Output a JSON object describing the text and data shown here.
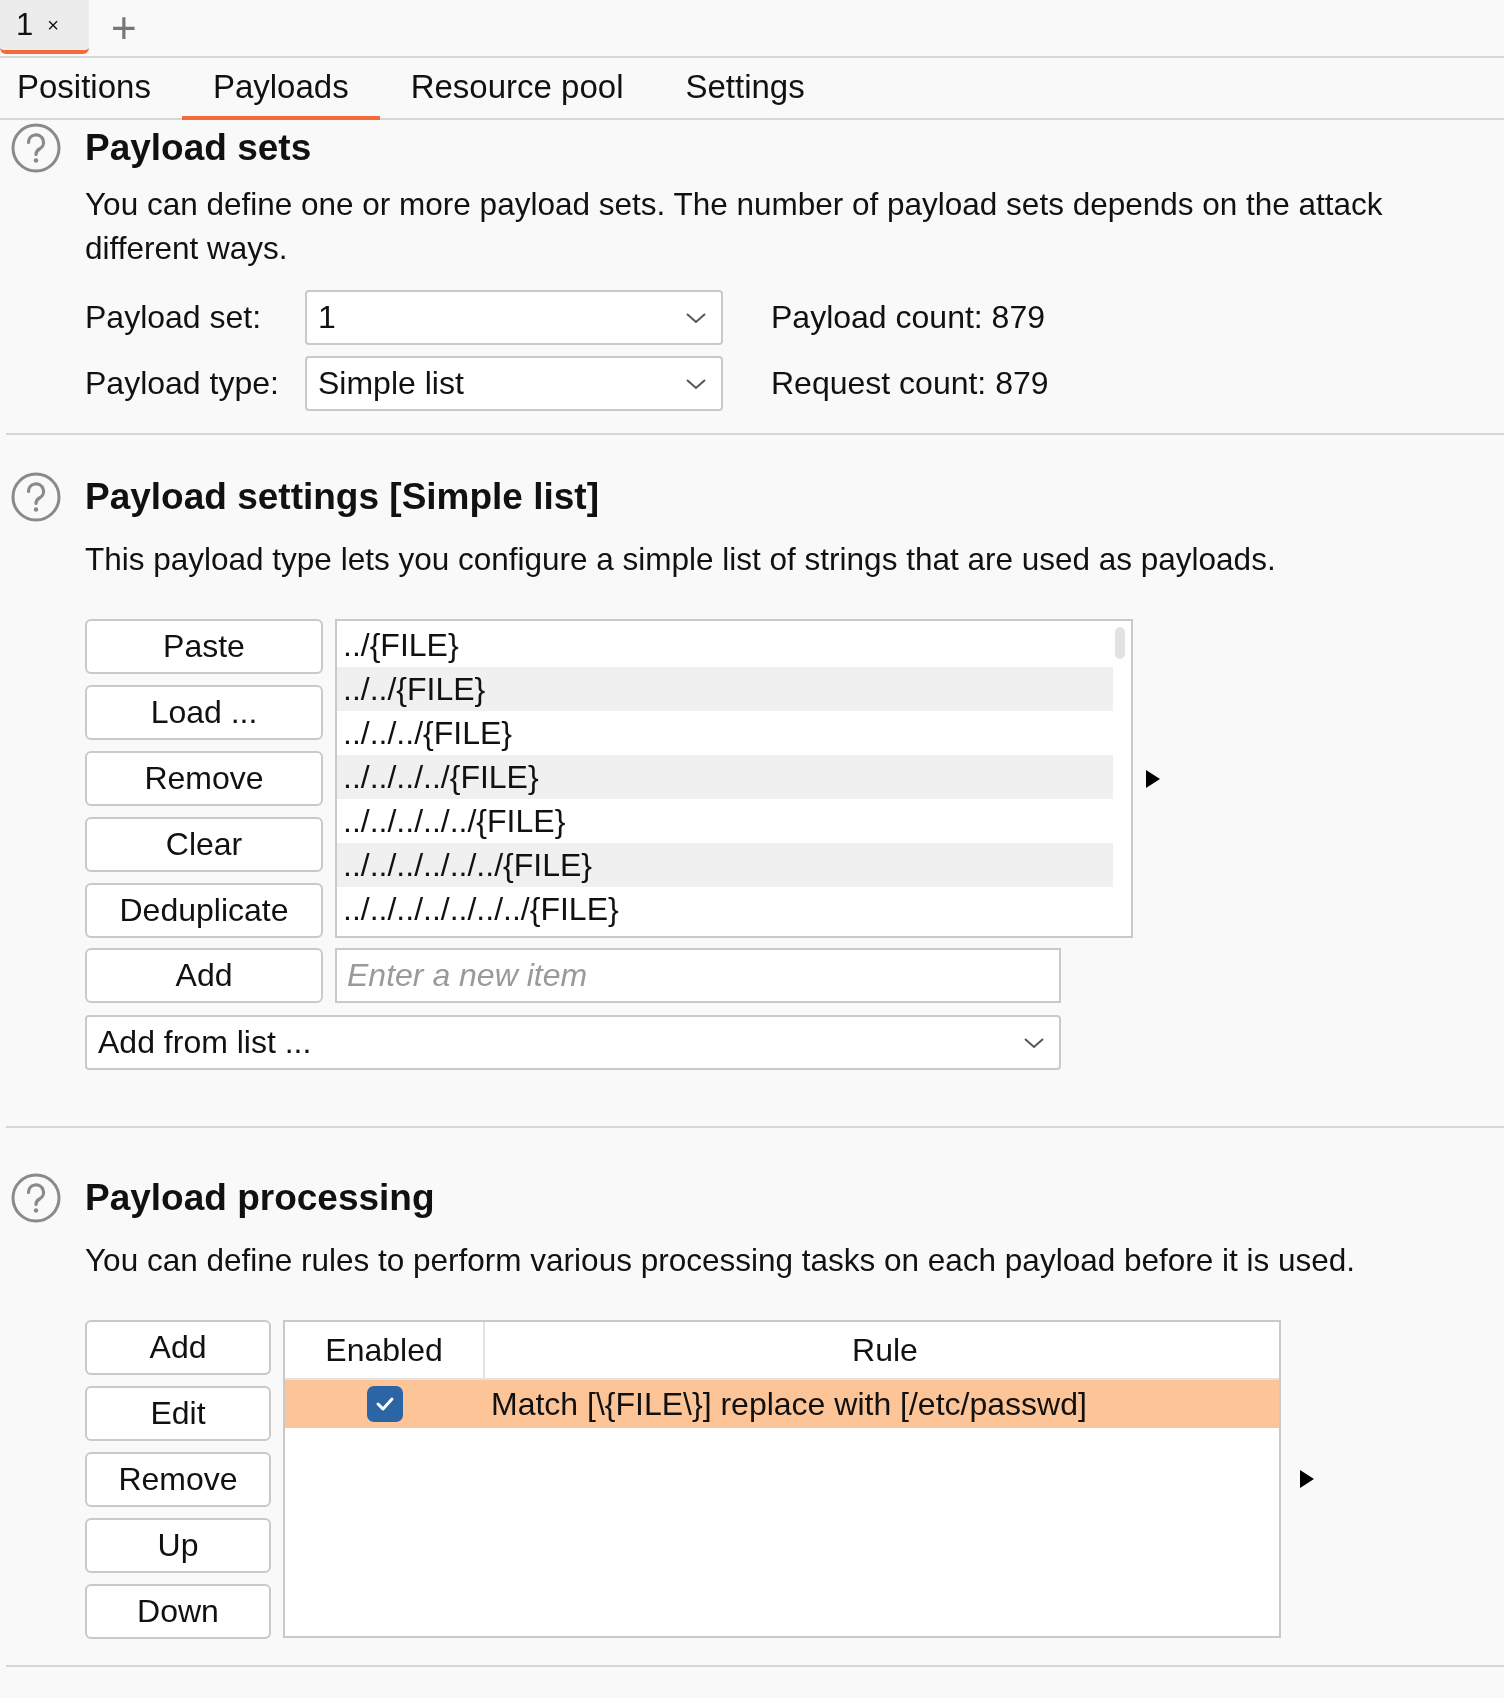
{
  "document_tabs": [
    {
      "label": "1",
      "close": "×",
      "selected": true
    }
  ],
  "new_tab": "+",
  "tabs": [
    {
      "label": "Positions",
      "selected": false
    },
    {
      "label": "Payloads",
      "selected": true
    },
    {
      "label": "Resource pool",
      "selected": false
    },
    {
      "label": "Settings",
      "selected": false
    }
  ],
  "payload_sets": {
    "title": "Payload sets",
    "description": "You can define one or more payload sets. The number of payload sets depends on the attack",
    "description_2": "different ways.",
    "set_label": "Payload set:",
    "set_value": "1",
    "type_label": "Payload type:",
    "type_value": "Simple list",
    "payload_count": "Payload count: 879",
    "request_count": "Request count: 879"
  },
  "payload_settings": {
    "title": "Payload settings [Simple list]",
    "description": "This payload type lets you configure a simple list of strings that are used as payloads.",
    "buttons": [
      "Paste",
      "Load ...",
      "Remove",
      "Clear",
      "Deduplicate"
    ],
    "items": [
      "../{FILE}",
      "../../{FILE}",
      "../../../{FILE}",
      "../../../../{FILE}",
      "../../../../../{FILE}",
      "../../../../../../{FILE}",
      "../../../../../../../{FILE}"
    ],
    "add_button": "Add",
    "new_item": {
      "placeholder": "Enter a new item"
    },
    "add_from_list": "Add from list ..."
  },
  "payload_processing": {
    "title": "Payload processing",
    "description": "You can define rules to perform various processing tasks on each payload before it is used.",
    "buttons": [
      "Add",
      "Edit",
      "Remove",
      "Up",
      "Down"
    ],
    "columns": [
      "Enabled",
      "Rule"
    ],
    "rows": [
      {
        "enabled": true,
        "rule": "Match [\\{FILE\\}] replace with [/etc/passwd]",
        "selected": true
      }
    ]
  }
}
